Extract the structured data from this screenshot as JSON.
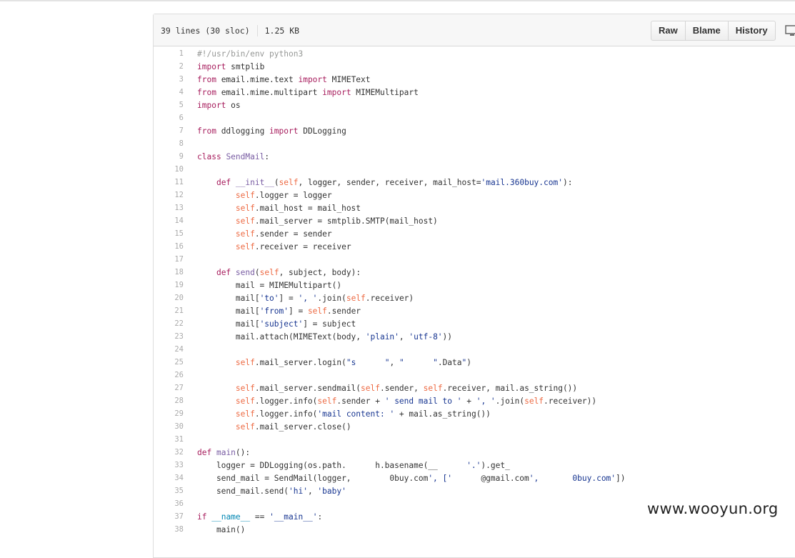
{
  "file_header": {
    "lines_info": "39 lines (30 sloc)",
    "size": "1.25 KB",
    "buttons": {
      "raw": "Raw",
      "blame": "Blame",
      "history": "History"
    },
    "desktop_icon": "desktop-icon"
  },
  "code_lines": [
    {
      "n": "1",
      "t": "#!/usr/bin/env python3"
    },
    {
      "n": "2",
      "t": "import smtplib"
    },
    {
      "n": "3",
      "t": "from email.mime.text import MIMEText"
    },
    {
      "n": "4",
      "t": "from email.mime.multipart import MIMEMultipart"
    },
    {
      "n": "5",
      "t": "import os"
    },
    {
      "n": "6",
      "t": ""
    },
    {
      "n": "7",
      "t": "from ddlogging import DDLogging"
    },
    {
      "n": "8",
      "t": ""
    },
    {
      "n": "9",
      "t": "class SendMail:"
    },
    {
      "n": "10",
      "t": ""
    },
    {
      "n": "11",
      "t": "    def __init__(self, logger, sender, receiver, mail_host='mail.360buy.com'):"
    },
    {
      "n": "12",
      "t": "        self.logger = logger"
    },
    {
      "n": "13",
      "t": "        self.mail_host = mail_host"
    },
    {
      "n": "14",
      "t": "        self.mail_server = smtplib.SMTP(mail_host)"
    },
    {
      "n": "15",
      "t": "        self.sender = sender"
    },
    {
      "n": "16",
      "t": "        self.receiver = receiver"
    },
    {
      "n": "17",
      "t": ""
    },
    {
      "n": "18",
      "t": "    def send(self, subject, body):"
    },
    {
      "n": "19",
      "t": "        mail = MIMEMultipart()"
    },
    {
      "n": "20",
      "t": "        mail['to'] = ', '.join(self.receiver)"
    },
    {
      "n": "21",
      "t": "        mail['from'] = self.sender"
    },
    {
      "n": "22",
      "t": "        mail['subject'] = subject"
    },
    {
      "n": "23",
      "t": "        mail.attach(MIMEText(body, 'plain', 'utf-8'))"
    },
    {
      "n": "24",
      "t": ""
    },
    {
      "n": "25",
      "t": "        self.mail_server.login(\"s      \", \"      \".Data\")"
    },
    {
      "n": "26",
      "t": ""
    },
    {
      "n": "27",
      "t": "        self.mail_server.sendmail(self.sender, self.receiver, mail.as_string())"
    },
    {
      "n": "28",
      "t": "        self.logger.info(self.sender + ' send mail to ' + ', '.join(self.receiver))"
    },
    {
      "n": "29",
      "t": "        self.logger.info('mail content: ' + mail.as_string())"
    },
    {
      "n": "30",
      "t": "        self.mail_server.close()"
    },
    {
      "n": "31",
      "t": ""
    },
    {
      "n": "32",
      "t": "def main():"
    },
    {
      "n": "33",
      "t": "    logger = DDLogging(os.path.      h.basename(__      '.').get_    "
    },
    {
      "n": "34",
      "t": "    send_mail = SendMail(logger,        0buy.com', ['      @gmail.com',       0buy.com'])"
    },
    {
      "n": "35",
      "t": "    send_mail.send('hi', 'baby'"
    },
    {
      "n": "36",
      "t": ""
    },
    {
      "n": "37",
      "t": "if __name__ == '__main__':"
    },
    {
      "n": "38",
      "t": "    main()"
    }
  ],
  "watermark": "www.wooyun.org",
  "colors": {
    "keyword": "#a71d5d",
    "string": "#183691",
    "constant": "#0086b3",
    "comment": "#969896",
    "self": "#ed6a43",
    "entity": "#795da3"
  }
}
